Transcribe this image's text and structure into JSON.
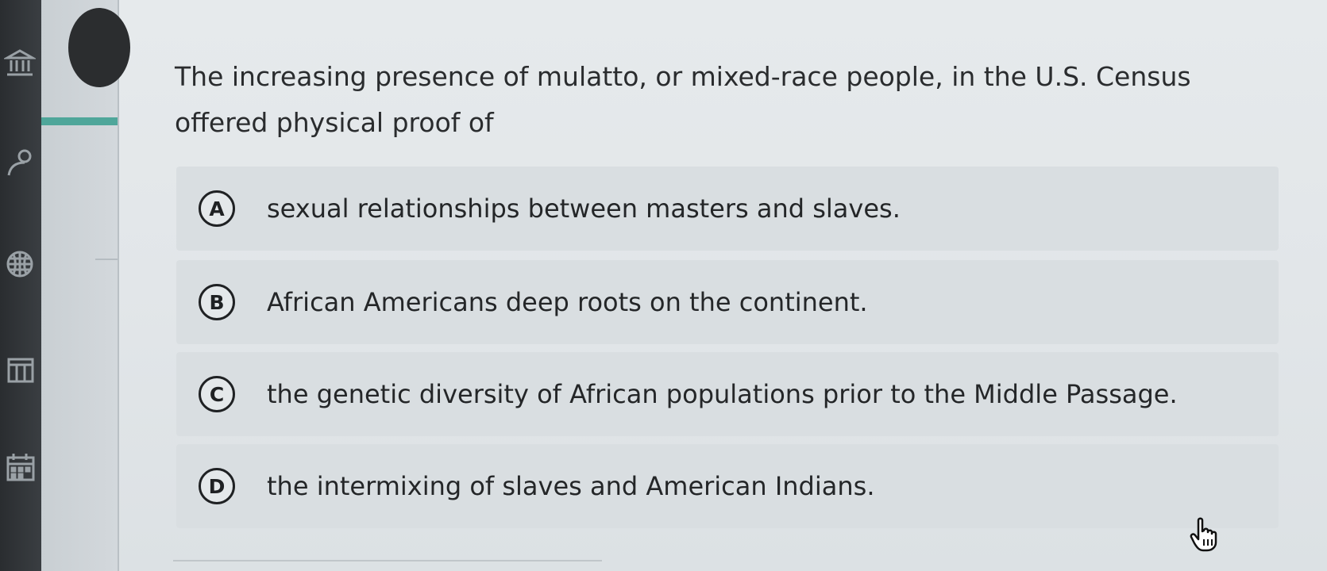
{
  "sidebar": {
    "icons": [
      "institution-icon",
      "person-search-icon",
      "globe-icon",
      "library-icon",
      "calendar-icon"
    ]
  },
  "question": {
    "text": "The increasing presence of mulatto, or mixed-race people, in the U.S. Census offered physical proof of"
  },
  "options": [
    {
      "letter": "A",
      "text": "sexual relationships between masters and slaves."
    },
    {
      "letter": "B",
      "text": "African Americans deep roots on the continent."
    },
    {
      "letter": "C",
      "text": "the genetic diversity of African populations prior to the Middle Passage."
    },
    {
      "letter": "D",
      "text": "the intermixing of slaves and American Indians."
    }
  ],
  "colors": {
    "accent": "#4fa69a",
    "rail": "#2f3236",
    "option_bg": "#d9dee1"
  }
}
